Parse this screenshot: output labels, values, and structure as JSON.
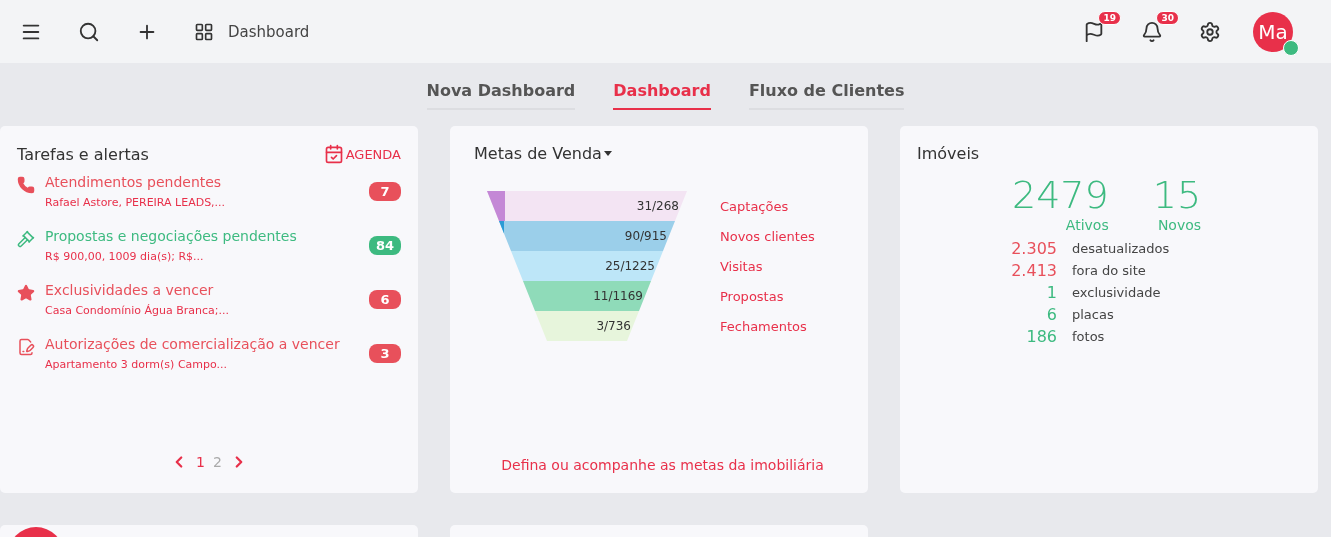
{
  "topbar": {
    "title": "Dashboard",
    "flag_count": "19",
    "bell_count": "30",
    "avatar": "Ma",
    "online": true
  },
  "tabs": [
    {
      "label": "Nova Dashboard",
      "selected": false
    },
    {
      "label": "Dashboard",
      "selected": true
    },
    {
      "label": "Fluxo de Clientes",
      "selected": false
    }
  ],
  "tasks": {
    "title": "Tarefas e alertas",
    "agenda": "AGENDA",
    "items": [
      {
        "kind": "phone",
        "title": "Atendimentos pendentes",
        "detail": "Rafael Astore, PEREIRA LEADS,...",
        "count": "7",
        "color": "#e8505b"
      },
      {
        "kind": "gavel",
        "title": "Propostas e negociações pendentes",
        "detail": "R$ 900,00, 1009 dia(s); R$...",
        "count": "84",
        "color": "#3dba80"
      },
      {
        "kind": "star",
        "title": "Exclusividades a vencer",
        "detail": "Casa Condomínio Água Branca;...",
        "count": "6",
        "color": "#e8505b"
      },
      {
        "kind": "document",
        "title": "Autorizações de comercialização a vencer",
        "detail": "Apartamento 3 dorm(s) Campo...",
        "count": "3",
        "color": "#e8505b"
      }
    ],
    "pages": [
      {
        "label": "1",
        "selected": true
      },
      {
        "label": "2",
        "selected": false
      }
    ]
  },
  "goals": {
    "title": "Metas de Venda",
    "stages": [
      {
        "value": "31/268",
        "label": "Captações",
        "color": "#f3e4f3",
        "progress": {
          "level": 0.09,
          "color": "#c488d6"
        }
      },
      {
        "value": "90/915",
        "label": "Novos clientes",
        "color": "#9bcfea",
        "progress": {
          "level": 0.03,
          "color": "#2b9bd6"
        }
      },
      {
        "value": "25/1225",
        "label": "Visitas",
        "color": "#bde6f8"
      },
      {
        "value": "11/1169",
        "label": "Propostas",
        "color": "#8fdbb9"
      },
      {
        "value": "3/736",
        "label": "Fechamentos",
        "color": "#e7f5dc"
      }
    ],
    "link": "Defina ou acompanhe as metas da imobiliária"
  },
  "properties": {
    "title": "Imóveis",
    "totals": [
      {
        "value": "2479",
        "label": "Ativos"
      },
      {
        "value": "15",
        "label": "Novos"
      }
    ],
    "stats": [
      {
        "value": "2.305",
        "label": "desatualizados",
        "color": "#e8505b"
      },
      {
        "value": "2.413",
        "label": "fora do site",
        "color": "#e8505b"
      },
      {
        "value": "1",
        "label": "exclusividade",
        "color": "#3dba80"
      },
      {
        "value": "6",
        "label": "placas",
        "color": "#3dba80"
      },
      {
        "value": "186",
        "label": "fotos",
        "color": "#3dba80"
      }
    ]
  }
}
